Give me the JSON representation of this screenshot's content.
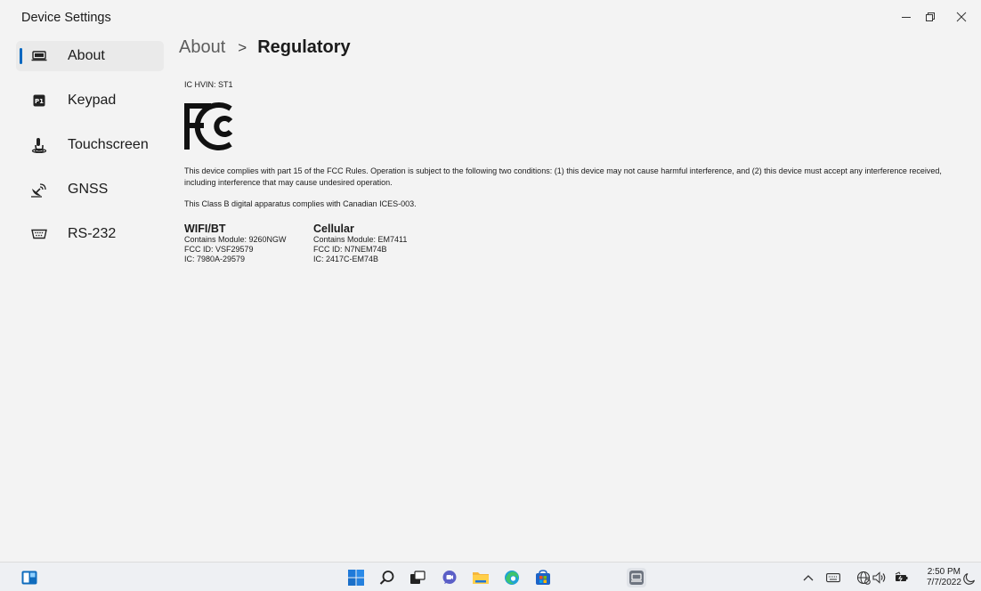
{
  "window": {
    "title": "Device Settings"
  },
  "sidebar": {
    "items": [
      {
        "label": "About",
        "icon": "laptop-icon",
        "active": true
      },
      {
        "label": "Keypad",
        "icon": "p1-key-icon",
        "active": false
      },
      {
        "label": "Touchscreen",
        "icon": "touch-hand-icon",
        "active": false
      },
      {
        "label": "GNSS",
        "icon": "satellite-icon",
        "active": false
      },
      {
        "label": "RS-232",
        "icon": "serial-port-icon",
        "active": false
      }
    ],
    "accent_color": "#0067c0"
  },
  "breadcrumb": {
    "parent": "About",
    "separator": ">",
    "current": "Regulatory"
  },
  "regulatory": {
    "hvin": "IC HVIN: ST1",
    "fcc_logo": "FC",
    "compliance_text": "This device complies with part 15 of the FCC Rules. Operation is subject to the following two conditions: (1) this device may not cause harmful interference, and (2) this device must accept any interference received, including interference that may cause undesired operation.",
    "class_b_text": "This Class B digital apparatus complies with Canadian ICES-003.",
    "modules": [
      {
        "title": "WIFI/BT",
        "lines": [
          "Contains Module: 9260NGW",
          "FCC ID: VSF29579",
          "IC: 7980A-29579"
        ]
      },
      {
        "title": "Cellular",
        "lines": [
          "Contains Module: EM7411",
          "FCC ID: N7NEM74B",
          "IC: 2417C-EM74B"
        ]
      }
    ]
  },
  "taskbar": {
    "apps": [
      "widgets-icon",
      "start-icon",
      "search-icon",
      "task-view-icon",
      "teams-chat-icon",
      "file-explorer-icon",
      "edge-icon",
      "store-icon",
      "device-settings-icon"
    ],
    "tray": [
      "chevron-up-icon",
      "keyboard-icon",
      "network-icon",
      "volume-icon",
      "battery-icon"
    ],
    "time": "2:50 PM",
    "date": "7/7/2022"
  }
}
